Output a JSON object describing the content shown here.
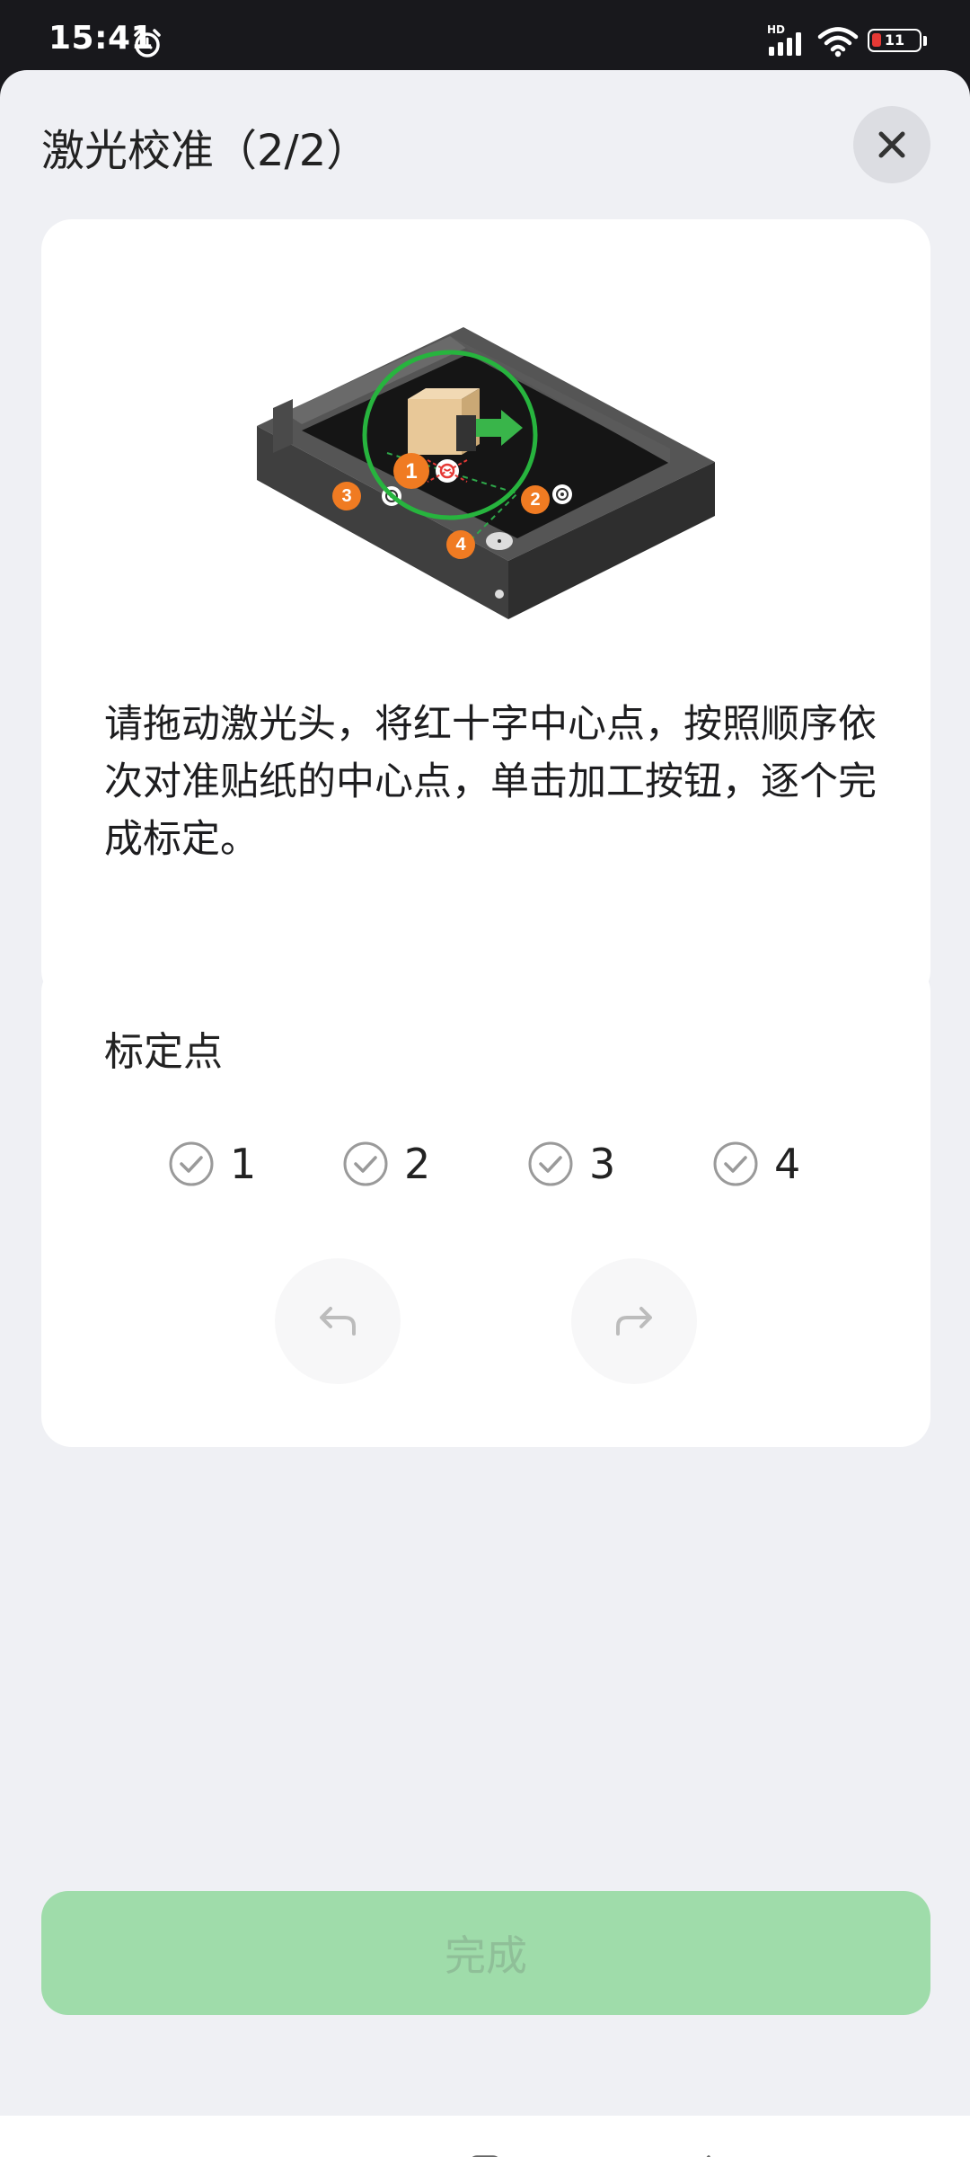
{
  "status_bar": {
    "time": "15:41",
    "network": "HD",
    "battery": "11"
  },
  "header": {
    "title": "激光校准（2/2）",
    "close_icon": "close-icon"
  },
  "instruction_card": {
    "illustration_icon": "laser-engraver-illustration",
    "marker_labels": [
      "1",
      "2",
      "3",
      "4"
    ],
    "description": "请拖动激光头，将红十字中心点，按照顺序依次对准贴纸的中心点，单击加工按钮，逐个完成标定。"
  },
  "calibration_card": {
    "title": "标定点",
    "points": [
      {
        "label": "1",
        "icon": "check-circle-icon"
      },
      {
        "label": "2",
        "icon": "check-circle-icon"
      },
      {
        "label": "3",
        "icon": "check-circle-icon"
      },
      {
        "label": "4",
        "icon": "check-circle-icon"
      }
    ],
    "undo_icon": "undo-icon",
    "redo_icon": "redo-icon"
  },
  "footer": {
    "done_label": "完成"
  },
  "nav_bar": {
    "items": [
      "menu-icon",
      "home-icon",
      "back-icon"
    ]
  },
  "colors": {
    "accent_green": "#9fdcaa",
    "background": "#eff0f4",
    "card": "#ffffff",
    "marker_orange": "#f07b22"
  }
}
